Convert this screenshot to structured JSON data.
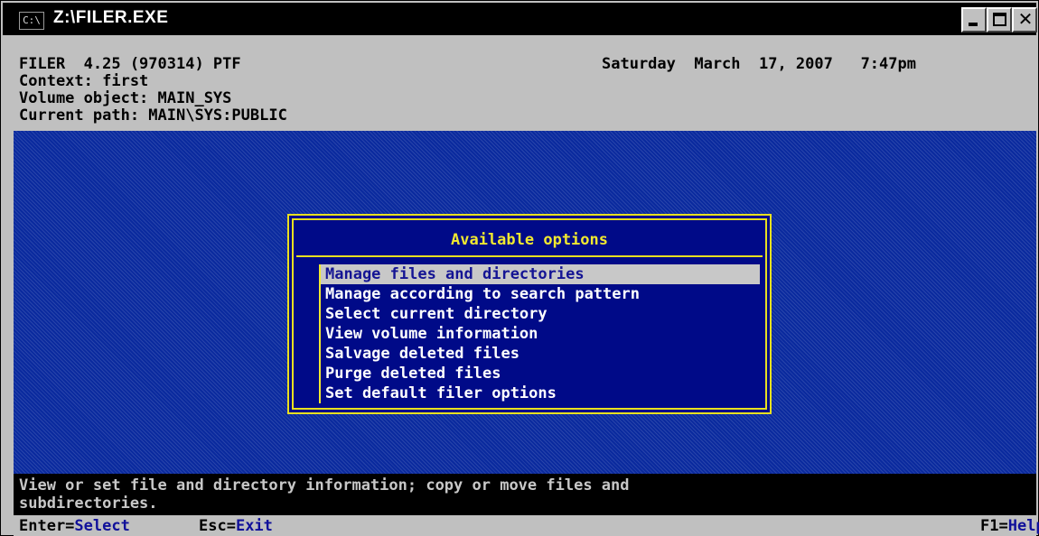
{
  "window": {
    "title": "Z:\\FILER.EXE",
    "icon_text": "C:\\"
  },
  "header": {
    "line1": "FILER  4.25 (970314) PTF",
    "datetime": "Saturday  March  17, 2007   7:47pm",
    "context": "Context: first",
    "volume": "Volume object: MAIN_SYS",
    "path": "Current path: MAIN\\SYS:PUBLIC"
  },
  "dialog": {
    "title": "Available options",
    "items": [
      "Manage files and directories",
      "Manage according to search pattern",
      "Select current directory",
      "View volume information",
      "Salvage deleted files",
      "Purge deleted files",
      "Set default filer options"
    ],
    "selected_index": 0
  },
  "helpline": "View or set file and directory information; copy or move files and\nsubdirectories.",
  "keys": {
    "enter_key": "Enter=",
    "enter_action": "Select",
    "esc_key": "Esc=",
    "esc_action": "Exit",
    "f1_key": "F1=",
    "f1_action": "Help"
  },
  "colors": {
    "desktop": "#0a2a9e",
    "dialog_bg": "#000a88",
    "dialog_border": "#e8e020",
    "selection_bg": "#c8c8c8"
  }
}
